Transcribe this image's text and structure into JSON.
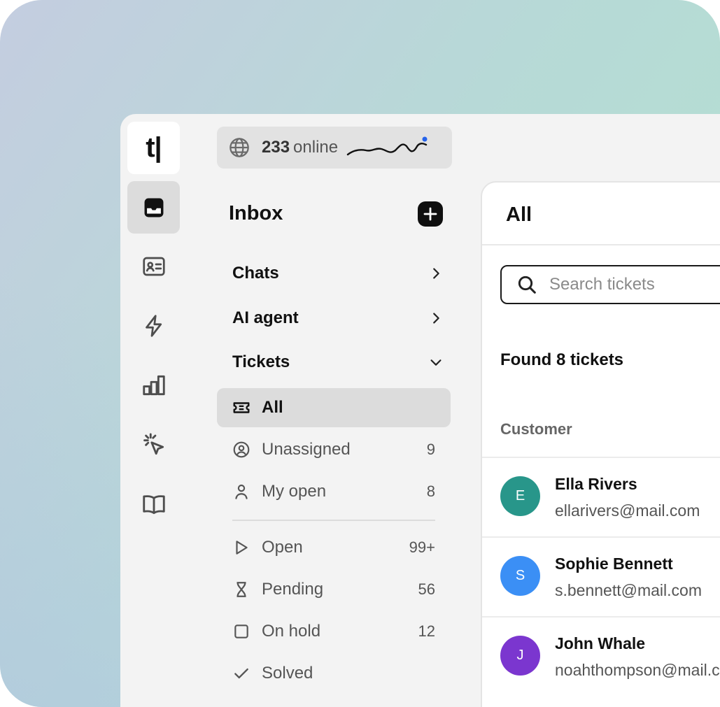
{
  "app": {
    "logo_text": "t|"
  },
  "rail": {
    "items": [
      {
        "name": "inbox",
        "icon": "inbox-icon",
        "active": true
      },
      {
        "name": "contacts",
        "icon": "contact-card-icon",
        "active": false
      },
      {
        "name": "automations",
        "icon": "lightning-icon",
        "active": false
      },
      {
        "name": "reports",
        "icon": "bar-chart-icon",
        "active": false
      },
      {
        "name": "tracking",
        "icon": "cursor-click-icon",
        "active": false
      },
      {
        "name": "knowledge-base",
        "icon": "book-icon",
        "active": false
      }
    ]
  },
  "online": {
    "count": "233",
    "label": "online",
    "status_color": "#2563eb"
  },
  "nav": {
    "title": "Inbox",
    "sections": {
      "chats": "Chats",
      "ai_agent": "AI agent",
      "tickets": "Tickets"
    },
    "items": [
      {
        "label": "All",
        "count": "",
        "icon": "ticket-icon",
        "active": true
      },
      {
        "label": "Unassigned",
        "count": "9",
        "icon": "user-circle-icon",
        "active": false
      },
      {
        "label": "My open",
        "count": "8",
        "icon": "user-icon",
        "active": false
      }
    ],
    "status_items": [
      {
        "label": "Open",
        "count": "99+",
        "icon": "play-icon"
      },
      {
        "label": "Pending",
        "count": "56",
        "icon": "hourglass-icon"
      },
      {
        "label": "On hold",
        "count": "12",
        "icon": "square-icon"
      },
      {
        "label": "Solved",
        "count": "",
        "icon": "check-icon"
      }
    ]
  },
  "main": {
    "title": "All",
    "search_placeholder": "Search tickets",
    "found_text": "Found 8 tickets",
    "column_header": "Customer",
    "customers": [
      {
        "initial": "E",
        "name": "Ella Rivers",
        "email": "ellarivers@mail.com",
        "color": "#28968a"
      },
      {
        "initial": "S",
        "name": "Sophie Bennett",
        "email": "s.bennett@mail.com",
        "color": "#3b8ff5"
      },
      {
        "initial": "J",
        "name": "John Whale",
        "email": "noahthompson@mail.com",
        "color": "#7b36cf"
      }
    ]
  }
}
